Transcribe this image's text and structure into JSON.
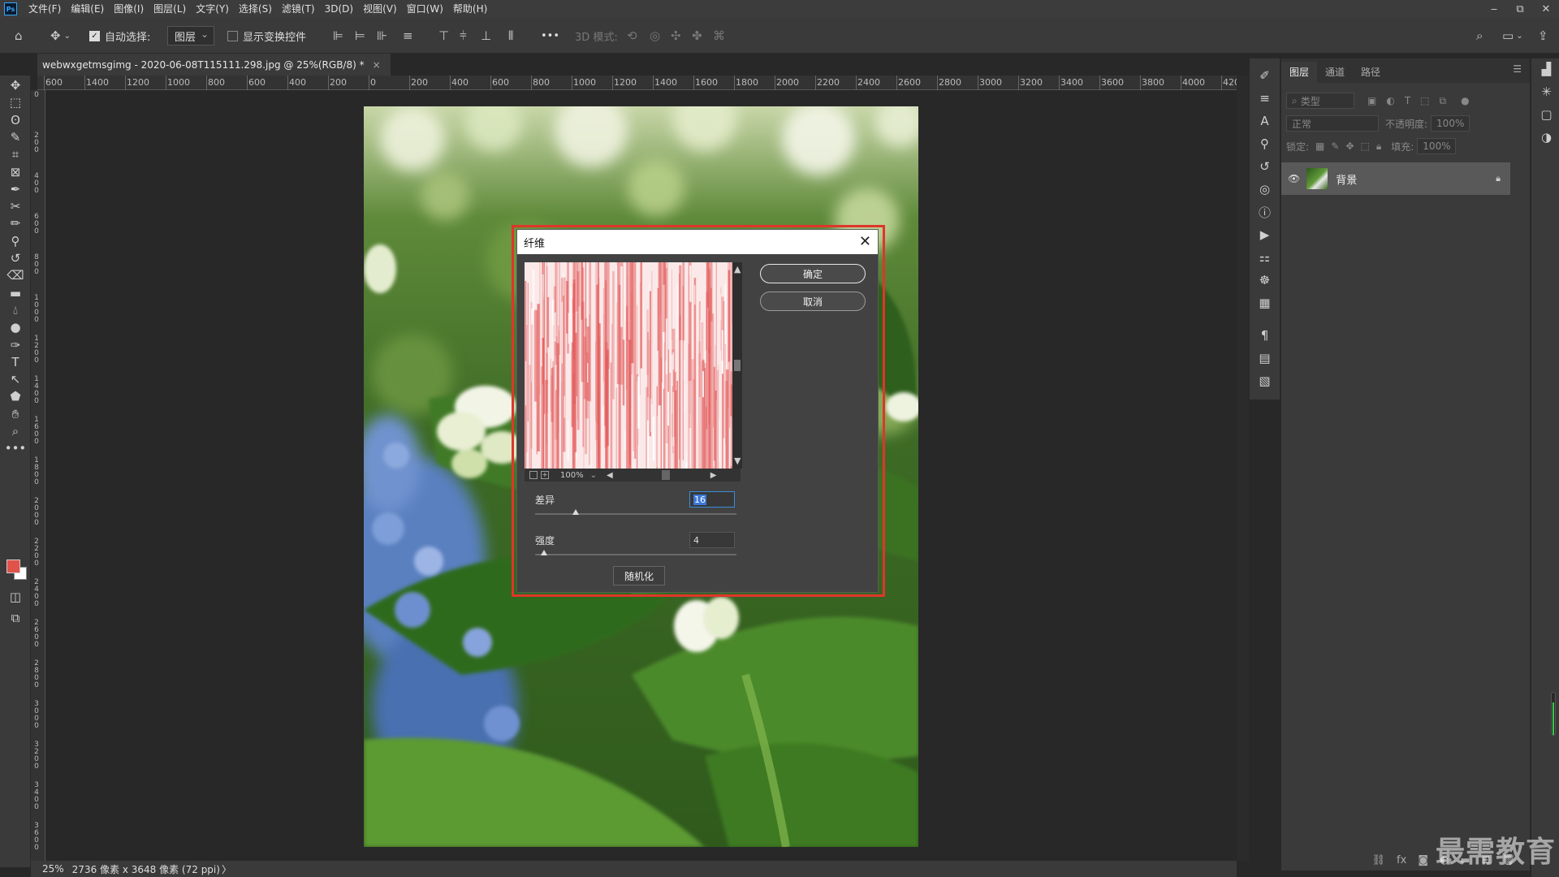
{
  "app": {
    "logo": "Ps"
  },
  "menu": [
    "文件(F)",
    "编辑(E)",
    "图像(I)",
    "图层(L)",
    "文字(Y)",
    "选择(S)",
    "滤镜(T)",
    "3D(D)",
    "视图(V)",
    "窗口(W)",
    "帮助(H)"
  ],
  "window_controls": {
    "minimize": "‒",
    "restore": "⧉",
    "close": "✕"
  },
  "options": {
    "auto_select_label": "自动选择:",
    "auto_select_checked": true,
    "auto_select_target": "图层",
    "show_transform_label": "显示变换控件",
    "show_transform_checked": false,
    "more": "•••",
    "mode_3d_label": "3D 模式:"
  },
  "document": {
    "tab_title": "webwxgetmsgimg - 2020-06-08T115111.298.jpg @ 25%(RGB/8) *",
    "tab_close": "×"
  },
  "ruler": {
    "h_labels": [
      "600",
      "1400",
      "1200",
      "1000",
      "800",
      "600",
      "400",
      "200",
      "0",
      "200",
      "400",
      "600",
      "800",
      "1000",
      "1200",
      "1400",
      "1600",
      "1800",
      "2000",
      "2200",
      "2400",
      "2600",
      "2800",
      "3000",
      "3200",
      "3400",
      "3600",
      "3800",
      "4000",
      "420"
    ],
    "v_labels": [
      "0",
      "200",
      "400",
      "600",
      "800",
      "1000",
      "1200",
      "1400",
      "1600",
      "1800",
      "2000",
      "2200",
      "2400",
      "2600",
      "2800",
      "3000",
      "3200",
      "3400",
      "3600"
    ]
  },
  "status": {
    "zoom": "25%",
    "doc_info": "2736 像素 x 3648 像素 (72 ppi)",
    "arrow": "〉"
  },
  "layers_panel": {
    "tabs": [
      "图层",
      "通道",
      "路径"
    ],
    "active_tab": 0,
    "filter_placeholder": "类型",
    "blend_mode": "正常",
    "opacity_label": "不透明度:",
    "opacity_value": "100%",
    "lock_label": "锁定:",
    "fill_label": "填充:",
    "fill_value": "100%",
    "layers": [
      {
        "name": "背景",
        "visible": true,
        "locked": true
      }
    ]
  },
  "dialog": {
    "title": "纤维",
    "ok": "确定",
    "cancel": "取消",
    "preview_zoom": "100%",
    "params": [
      {
        "label": "差异",
        "value": "16",
        "fraction": 0.2
      },
      {
        "label": "强度",
        "value": "4",
        "fraction": 0.045
      }
    ],
    "randomize": "随机化",
    "fiber_color": "#e35d5d"
  },
  "colors": {
    "foreground": "#e0524a",
    "background": "#ffffff",
    "highlight_border": "#e0352b"
  },
  "watermark": "最需教育"
}
